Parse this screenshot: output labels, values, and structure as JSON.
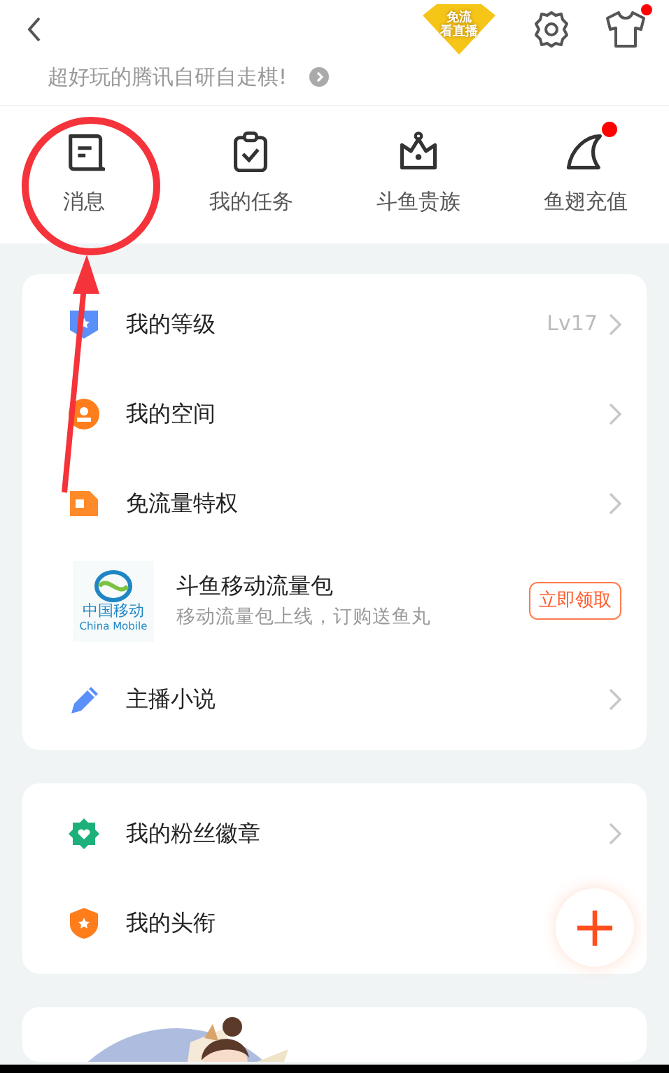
{
  "header": {
    "badge": {
      "line_1": "免流",
      "line_2": "看直播"
    },
    "wardrobe_dot": true
  },
  "banner": {
    "text": "超好玩的腾讯自研自走棋!"
  },
  "shortcuts": [
    {
      "label": "消息",
      "dot": false
    },
    {
      "label": "我的任务",
      "dot": false
    },
    {
      "label": "斗鱼贵族",
      "dot": false
    },
    {
      "label": "鱼翅充值",
      "dot": true
    }
  ],
  "groups": [
    {
      "rows": [
        {
          "kind": "link",
          "label": "我的等级",
          "value": "Lv17"
        },
        {
          "kind": "link",
          "label": "我的空间"
        },
        {
          "kind": "link",
          "label": "免流量特权"
        },
        {
          "kind": "promo",
          "label": "斗鱼移动流量包",
          "subtitle": "移动流量包上线，订购送鱼丸",
          "logo_text": "中国移动",
          "logo_subtext": "China Mobile",
          "button": "立即领取"
        },
        {
          "kind": "link",
          "label": "主播小说"
        }
      ]
    },
    {
      "rows": [
        {
          "kind": "link",
          "label": "我的粉丝徽章"
        },
        {
          "kind": "plain",
          "label": "我的头衔"
        }
      ]
    }
  ],
  "fab": {
    "label": "+"
  }
}
